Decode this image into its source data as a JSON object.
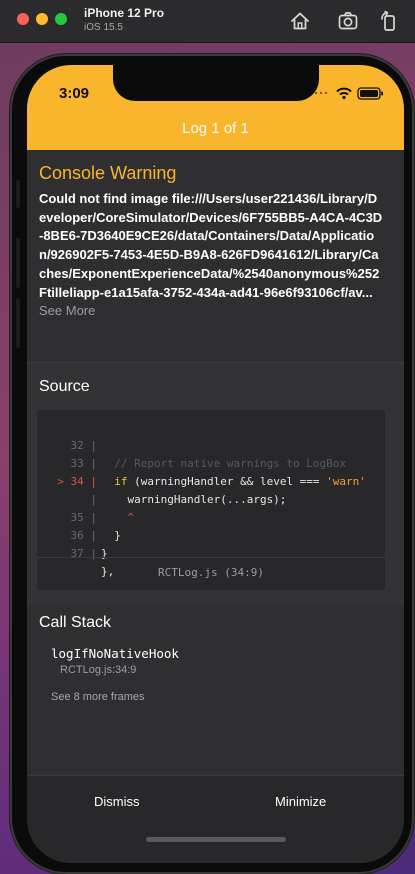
{
  "simulator": {
    "device_name": "iPhone 12 Pro",
    "os_version": "iOS 15.5",
    "icons": [
      "home-icon",
      "screenshot-icon",
      "rotate-icon"
    ]
  },
  "status_bar": {
    "time": "3:09"
  },
  "header": {
    "title": "Log 1 of 1",
    "color": "#f9b52b"
  },
  "warning": {
    "title": "Console Warning",
    "message": "Could not find image file:///Users/user221436/Library/Developer/CoreSimulator/Devices/6F755BB5-A4CA-4C3D-8BE6-7D3640E9CE26/data/Containers/Data/Application/926902F5-7453-4E5D-B9A8-626FD9641612/Library/Caches/ExponentExperienceData/%2540anonymous%252Ftilleliapp-e1a15afa-3752-434a-ad41-96e6f93106cf/av...",
    "see_more": " See More"
  },
  "source": {
    "title": "Source",
    "lines": [
      {
        "gutter": "32 |",
        "code": "  // Report native warnings to LogBox"
      },
      {
        "gutter": "33 |",
        "code": "  if (warningHandler && level === 'warn'"
      },
      {
        "gutter": "> 34 |",
        "code": "    warningHandler(...args);"
      },
      {
        "gutter": "|",
        "code": "    ^"
      },
      {
        "gutter": "35 |",
        "code": "  }"
      },
      {
        "gutter": "36 |",
        "code": "}"
      },
      {
        "gutter": "37 |",
        "code": "},"
      }
    ],
    "file": "RCTLog.js (34:9)"
  },
  "call_stack": {
    "title": "Call Stack",
    "frames": [
      {
        "name": "logIfNoNativeHook",
        "location": "RCTLog.js:34:9"
      }
    ],
    "more": "See 8 more frames"
  },
  "footer": {
    "dismiss": "Dismiss",
    "minimize": "Minimize"
  }
}
